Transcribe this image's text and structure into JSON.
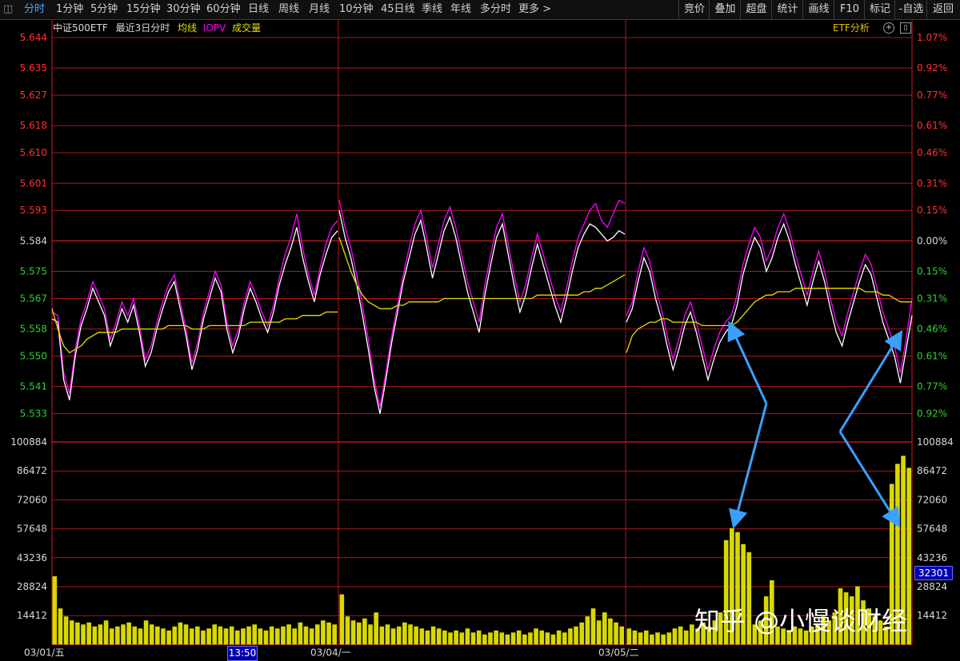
{
  "toolbar": {
    "left_items": [
      "分时",
      "1分钟",
      "5分钟",
      "15分钟",
      "30分钟",
      "60分钟",
      "日线",
      "周线",
      "月线",
      "10分钟",
      "45日线",
      "季线",
      "年线",
      "多分时",
      "更多 >"
    ],
    "right_items": [
      "竞价",
      "叠加",
      "超盘",
      "统计",
      "画线",
      "F10",
      "标记",
      "-自选",
      "返回"
    ]
  },
  "legend": {
    "name": "中证500ETF",
    "period": "最近3日分时",
    "avg_label": "均线",
    "iopv_label": "IOPV",
    "volume_label": "成交量",
    "etf_analysis": "ETF分析"
  },
  "price_axis": {
    "left": [
      "5.644",
      "5.635",
      "5.627",
      "5.618",
      "5.610",
      "5.601",
      "5.593",
      "5.584",
      "5.575",
      "5.567",
      "5.558",
      "5.550",
      "5.541",
      "5.533"
    ],
    "right": [
      "1.07%",
      "0.92%",
      "0.77%",
      "0.61%",
      "0.46%",
      "0.31%",
      "0.15%",
      "0.00%",
      "0.15%",
      "0.31%",
      "0.46%",
      "0.61%",
      "0.77%",
      "0.92%"
    ],
    "prev_close": 5.584
  },
  "volume_axis": [
    "100884",
    "86472",
    "72060",
    "57648",
    "43236",
    "28824",
    "14412"
  ],
  "volume_cursor": "32301",
  "date_axis": [
    "03/01/五",
    "03/04/一",
    "03/05/二"
  ],
  "time_cursor": "13:50",
  "watermark": "知乎 @小慢谈财经",
  "colors": {
    "price_line": "#ffffff",
    "iopv_line": "#ff00ff",
    "avg_line": "#e6e000",
    "volume_bar": "#d8d800",
    "grid": "#b01818",
    "up_text": "#ff3030",
    "down_text": "#30d030",
    "arrow": "#3aa0ff"
  },
  "chart_data": {
    "type": "line",
    "series": [
      {
        "name": "IOPV",
        "values": [
          [
            5.563,
            5.562,
            5.545,
            5.539,
            5.552,
            5.561,
            5.566,
            5.572,
            5.568,
            5.564,
            5.555,
            5.56,
            5.566,
            5.562,
            5.567,
            5.559,
            5.549,
            5.553,
            5.56,
            5.566,
            5.571,
            5.574,
            5.566,
            5.558,
            5.548,
            5.554,
            5.563,
            5.569,
            5.575,
            5.571,
            5.56,
            5.553,
            5.558,
            5.566,
            5.572,
            5.568,
            5.563,
            5.559,
            5.565,
            5.573,
            5.58,
            5.585,
            5.592,
            5.582,
            5.574,
            5.568,
            5.576,
            5.583,
            5.588,
            5.59
          ],
          [
            5.596,
            5.588,
            5.582,
            5.574,
            5.565,
            5.555,
            5.543,
            5.535,
            5.545,
            5.556,
            5.565,
            5.574,
            5.582,
            5.589,
            5.593,
            5.585,
            5.576,
            5.583,
            5.59,
            5.594,
            5.588,
            5.58,
            5.572,
            5.566,
            5.56,
            5.571,
            5.58,
            5.588,
            5.592,
            5.583,
            5.574,
            5.566,
            5.571,
            5.579,
            5.586,
            5.58,
            5.574,
            5.568,
            5.563,
            5.57,
            5.578,
            5.585,
            5.589,
            5.593,
            5.595,
            5.59,
            5.588,
            5.592,
            5.596,
            5.595
          ],
          [
            5.562,
            5.566,
            5.575,
            5.582,
            5.578,
            5.57,
            5.564,
            5.556,
            5.549,
            5.555,
            5.562,
            5.566,
            5.56,
            5.553,
            5.546,
            5.552,
            5.557,
            5.56,
            5.562,
            5.568,
            5.577,
            5.583,
            5.588,
            5.585,
            5.578,
            5.582,
            5.588,
            5.592,
            5.587,
            5.58,
            5.574,
            5.568,
            5.575,
            5.581,
            5.575,
            5.567,
            5.56,
            5.556,
            5.563,
            5.569,
            5.575,
            5.58,
            5.577,
            5.57,
            5.563,
            5.558,
            5.553,
            5.545,
            5.555,
            5.567
          ]
        ]
      },
      {
        "name": "price",
        "values": [
          [
            5.561,
            5.56,
            5.543,
            5.537,
            5.55,
            5.559,
            5.564,
            5.57,
            5.566,
            5.562,
            5.553,
            5.558,
            5.564,
            5.56,
            5.565,
            5.557,
            5.547,
            5.551,
            5.558,
            5.564,
            5.569,
            5.572,
            5.564,
            5.556,
            5.546,
            5.552,
            5.561,
            5.567,
            5.573,
            5.569,
            5.558,
            5.551,
            5.556,
            5.564,
            5.57,
            5.566,
            5.561,
            5.557,
            5.563,
            5.571,
            5.577,
            5.582,
            5.588,
            5.579,
            5.572,
            5.566,
            5.574,
            5.58,
            5.585,
            5.587
          ],
          [
            5.593,
            5.585,
            5.579,
            5.571,
            5.562,
            5.552,
            5.541,
            5.533,
            5.543,
            5.554,
            5.563,
            5.572,
            5.579,
            5.586,
            5.59,
            5.582,
            5.573,
            5.58,
            5.587,
            5.591,
            5.585,
            5.577,
            5.569,
            5.563,
            5.557,
            5.568,
            5.577,
            5.585,
            5.589,
            5.58,
            5.571,
            5.563,
            5.568,
            5.576,
            5.583,
            5.577,
            5.571,
            5.565,
            5.56,
            5.567,
            5.575,
            5.582,
            5.586,
            5.589,
            5.588,
            5.586,
            5.584,
            5.585,
            5.587,
            5.586
          ],
          [
            5.56,
            5.564,
            5.572,
            5.579,
            5.575,
            5.567,
            5.561,
            5.553,
            5.546,
            5.552,
            5.559,
            5.563,
            5.557,
            5.55,
            5.543,
            5.549,
            5.554,
            5.557,
            5.559,
            5.565,
            5.574,
            5.58,
            5.585,
            5.582,
            5.575,
            5.579,
            5.585,
            5.589,
            5.584,
            5.577,
            5.571,
            5.565,
            5.572,
            5.578,
            5.572,
            5.564,
            5.557,
            5.553,
            5.56,
            5.566,
            5.572,
            5.577,
            5.574,
            5.567,
            5.56,
            5.555,
            5.55,
            5.542,
            5.552,
            5.562
          ]
        ]
      },
      {
        "name": "均线",
        "values": [
          [
            5.564,
            5.558,
            5.553,
            5.551,
            5.552,
            5.553,
            5.555,
            5.556,
            5.557,
            5.557,
            5.557,
            5.557,
            5.558,
            5.558,
            5.558,
            5.558,
            5.558,
            5.558,
            5.558,
            5.558,
            5.559,
            5.559,
            5.559,
            5.559,
            5.558,
            5.558,
            5.558,
            5.559,
            5.559,
            5.559,
            5.559,
            5.559,
            5.559,
            5.559,
            5.56,
            5.56,
            5.56,
            5.56,
            5.56,
            5.56,
            5.561,
            5.561,
            5.561,
            5.562,
            5.562,
            5.562,
            5.562,
            5.563,
            5.563,
            5.563
          ],
          [
            5.585,
            5.58,
            5.575,
            5.571,
            5.568,
            5.566,
            5.565,
            5.564,
            5.564,
            5.564,
            5.565,
            5.565,
            5.566,
            5.566,
            5.566,
            5.566,
            5.566,
            5.566,
            5.567,
            5.567,
            5.567,
            5.567,
            5.567,
            5.567,
            5.567,
            5.567,
            5.567,
            5.567,
            5.567,
            5.567,
            5.567,
            5.567,
            5.567,
            5.567,
            5.568,
            5.568,
            5.568,
            5.568,
            5.568,
            5.568,
            5.568,
            5.568,
            5.569,
            5.569,
            5.57,
            5.57,
            5.571,
            5.572,
            5.573,
            5.574
          ],
          [
            5.551,
            5.556,
            5.558,
            5.559,
            5.56,
            5.56,
            5.561,
            5.561,
            5.56,
            5.56,
            5.56,
            5.56,
            5.56,
            5.559,
            5.559,
            5.559,
            5.559,
            5.559,
            5.559,
            5.56,
            5.562,
            5.564,
            5.566,
            5.567,
            5.568,
            5.568,
            5.569,
            5.569,
            5.569,
            5.57,
            5.57,
            5.57,
            5.57,
            5.57,
            5.57,
            5.57,
            5.57,
            5.57,
            5.57,
            5.57,
            5.57,
            5.569,
            5.569,
            5.569,
            5.568,
            5.568,
            5.567,
            5.566,
            5.566,
            5.566
          ]
        ]
      }
    ],
    "volume": [
      [
        34000,
        18000,
        14000,
        12000,
        11000,
        10000,
        11000,
        9000,
        10000,
        12000,
        8000,
        9000,
        10000,
        11000,
        9000,
        8000,
        12000,
        10000,
        9000,
        8000,
        7000,
        9000,
        11000,
        10000,
        8000,
        9000,
        7000,
        8000,
        10000,
        9000,
        8000,
        9000,
        7000,
        8000,
        9000,
        10000,
        8000,
        7000,
        9000,
        8000,
        9000,
        10000,
        8000,
        11000,
        9000,
        8000,
        10000,
        12000,
        11000,
        10000
      ],
      [
        25000,
        14000,
        12000,
        11000,
        13000,
        10000,
        16000,
        9000,
        10000,
        8000,
        9000,
        11000,
        10000,
        9000,
        8000,
        7000,
        9000,
        8000,
        7000,
        6000,
        7000,
        6000,
        8000,
        6000,
        7000,
        5000,
        6000,
        7000,
        6000,
        5000,
        6000,
        7000,
        5000,
        6000,
        8000,
        7000,
        6000,
        5000,
        7000,
        6000,
        8000,
        9000,
        11000,
        14000,
        18000,
        12000,
        16000,
        13000,
        11000,
        9000
      ],
      [
        8000,
        7000,
        6000,
        7000,
        5000,
        6000,
        5000,
        6000,
        8000,
        9000,
        7000,
        10000,
        8000,
        11000,
        9000,
        12000,
        16000,
        52000,
        58000,
        56000,
        50000,
        46000,
        10000,
        12000,
        24000,
        32000,
        9000,
        8000,
        7000,
        9000,
        8000,
        7000,
        9000,
        10000,
        14000,
        12000,
        16000,
        28000,
        26000,
        24000,
        29000,
        22000,
        18000,
        14000,
        12000,
        9000,
        80000,
        90000,
        94000,
        88000
      ]
    ],
    "annotations": [
      "arrows pointing to volume spikes near 57648 level on 03/05"
    ]
  }
}
